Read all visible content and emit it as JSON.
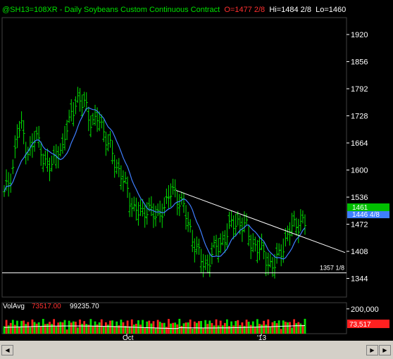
{
  "header": {
    "symbol": "@SH13=108XR - Daily  Soybeans Custom Continuous Contract",
    "last": "O=1477 2/8",
    "hi": "Hi=1484 2/8",
    "lo": "Lo=1460"
  },
  "price_axis": {
    "ticks": [
      "1920",
      "1856",
      "1792",
      "1728",
      "1664",
      "1600",
      "1536",
      "1472",
      "1408",
      "1344"
    ],
    "last_price_tag": "1461",
    "ma_tag": "1446 4/8",
    "support_label": "1357 1/8"
  },
  "volume_panel": {
    "label": "VolAvg",
    "value1": "73517.00",
    "value2": "99235.70",
    "axis_tick": "200,000",
    "last_tag": "73,517"
  },
  "time_axis": {
    "labels": [
      "Oct",
      "'13"
    ]
  },
  "colors": {
    "background": "#000000",
    "bars": "#00e000",
    "moving_average": "#3f7fff",
    "trendline": "#ffffff",
    "volume_up": "#00e000",
    "volume_down": "#ff2020",
    "last_tag_bg": "#00c000",
    "ma_tag_bg": "#3f7fff",
    "vol_tag_bg": "#ff2020"
  },
  "chart_data": {
    "type": "bar",
    "series_name": "Soybeans daily OHLC",
    "ylim": [
      1300,
      1960
    ],
    "close_path": [
      1540,
      1570,
      1610,
      1690,
      1700,
      1650,
      1640,
      1680,
      1660,
      1620,
      1600,
      1620,
      1650,
      1640,
      1700,
      1740,
      1760,
      1750,
      1770,
      1720,
      1700,
      1730,
      1700,
      1660,
      1640,
      1610,
      1590,
      1560,
      1530,
      1510,
      1500,
      1490,
      1520,
      1500,
      1480,
      1510,
      1520,
      1540,
      1550,
      1530,
      1510,
      1470,
      1440,
      1410,
      1380,
      1370,
      1400,
      1410,
      1420,
      1440,
      1460,
      1470,
      1480,
      1470,
      1460,
      1430,
      1420,
      1410,
      1400,
      1380,
      1370,
      1390,
      1420,
      1440,
      1460,
      1470,
      1480,
      1470
    ],
    "trendline": {
      "from": 1552,
      "to": 1405
    },
    "support_line": 1357.125,
    "volume_avg": 73517,
    "volume_ylim": [
      0,
      250000
    ]
  }
}
